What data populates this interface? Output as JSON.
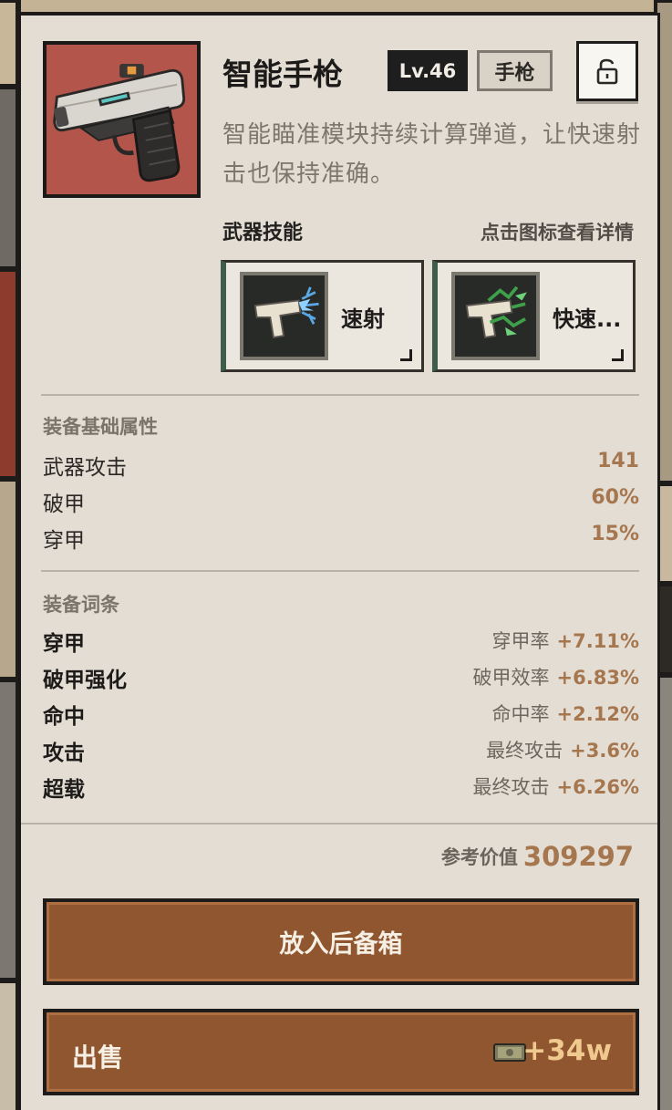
{
  "item": {
    "name": "智能手枪",
    "level": "Lv.46",
    "type": "手枪",
    "description": "智能瞄准模块持续计算弹道，让快速射击也保持准确。",
    "icon": "pistol-icon",
    "lock_icon": "unlock-icon"
  },
  "skills": {
    "title": "武器技能",
    "hint": "点击图标查看详情",
    "items": [
      {
        "label": "速射",
        "icon": "pistol-blue-spark-icon"
      },
      {
        "label": "快速...",
        "icon": "pistol-green-spark-icon"
      }
    ]
  },
  "base_stats": {
    "title": "装备基础属性",
    "rows": [
      {
        "label": "武器攻击",
        "value": "141"
      },
      {
        "label": "破甲",
        "value": "60%"
      },
      {
        "label": "穿甲",
        "value": "15%"
      }
    ]
  },
  "affixes": {
    "title": "装备词条",
    "rows": [
      {
        "name": "穿甲",
        "desc": "穿甲率",
        "value": "+7.11%"
      },
      {
        "name": "破甲强化",
        "desc": "破甲效率",
        "value": "+6.83%"
      },
      {
        "name": "命中",
        "desc": "命中率",
        "value": "+2.12%"
      },
      {
        "name": "攻击",
        "desc": "最终攻击",
        "value": "+3.6%"
      },
      {
        "name": "超载",
        "desc": "最终攻击",
        "value": "+6.26%"
      }
    ]
  },
  "reference": {
    "label": "参考价值",
    "value": "309297"
  },
  "actions": {
    "store_label": "放入后备箱",
    "sell_label": "出售",
    "sell_amount": "+34w",
    "money_icon": "cash-icon"
  },
  "colors": {
    "panel_bg": "#e3ddd3",
    "accent_value": "#a6764f",
    "button_brown": "#8f5630",
    "sell_amount": "#f0c98f"
  }
}
